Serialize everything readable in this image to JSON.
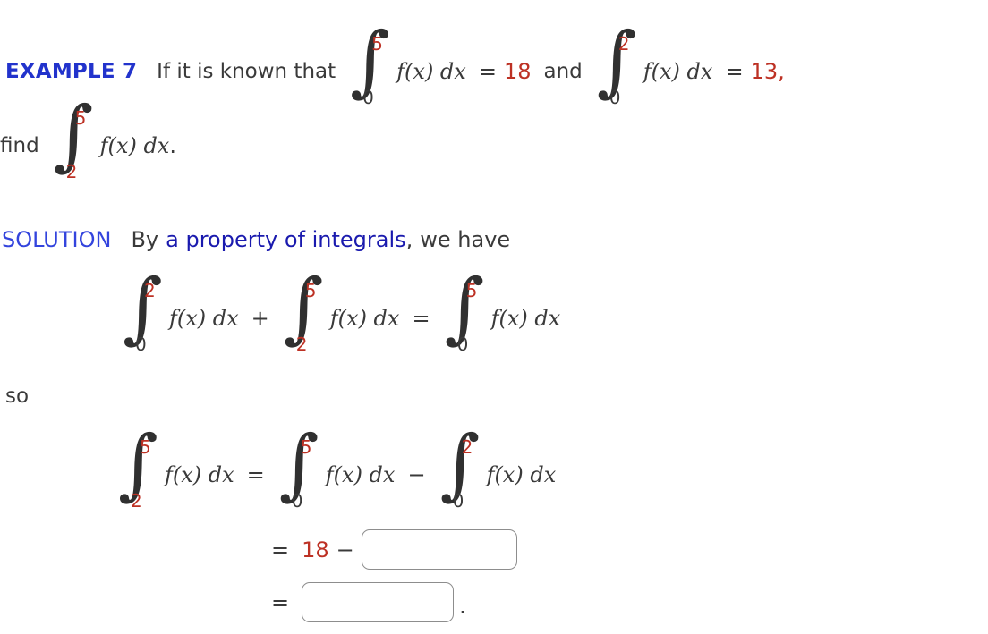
{
  "colors": {
    "example_blue": "#2233cc",
    "solution_blue": "#3344dd",
    "link_blue": "#1a1aae",
    "accent_red": "#bd3124",
    "text_gray": "#3a3a3a",
    "box_border": "#8d8d8d"
  },
  "problem": {
    "example_label": "EXAMPLE 7",
    "intro_text": "If it is known that",
    "given_1": {
      "lower": "0",
      "upper": "5",
      "integrand": "f(x) dx",
      "equals": "=",
      "value": "18"
    },
    "conjunction": "and",
    "given_2": {
      "lower": "0",
      "upper": "2",
      "integrand": "f(x) dx",
      "equals": "=",
      "value": "13",
      "trailing": ","
    },
    "find_word": "find",
    "find_integral": {
      "lower": "2",
      "upper": "5",
      "integrand": "f(x) dx",
      "trailing": "."
    }
  },
  "solution": {
    "label": "SOLUTION",
    "by_word": "By",
    "link_text": "a property of integrals",
    "link_comma": ",",
    "tail_text": "we have",
    "so_word": "so",
    "identity": {
      "term_1": {
        "lower": "0",
        "upper": "2",
        "integrand": "f(x) dx"
      },
      "operator_1": "+",
      "term_2": {
        "lower": "2",
        "upper": "5",
        "integrand": "f(x) dx"
      },
      "operator_2": "=",
      "term_3": {
        "lower": "0",
        "upper": "5",
        "integrand": "f(x) dx"
      }
    },
    "final_identity": {
      "term_1": {
        "lower": "2",
        "upper": "5",
        "integrand": "f(x) dx"
      },
      "operator_1": "=",
      "term_2": {
        "lower": "0",
        "upper": "5",
        "integrand": "f(x) dx"
      },
      "operator_2": "−",
      "term_3": {
        "lower": "0",
        "upper": "2",
        "integrand": "f(x) dx"
      }
    },
    "step_18": {
      "equals": "=",
      "known_value": "18",
      "minus": "−",
      "answer_value": "",
      "answer_placeholder": ""
    },
    "step_result": {
      "equals": "=",
      "answer_value": "",
      "answer_placeholder": "",
      "period": "."
    }
  },
  "glyphs": {
    "integral_sign": "∫"
  }
}
